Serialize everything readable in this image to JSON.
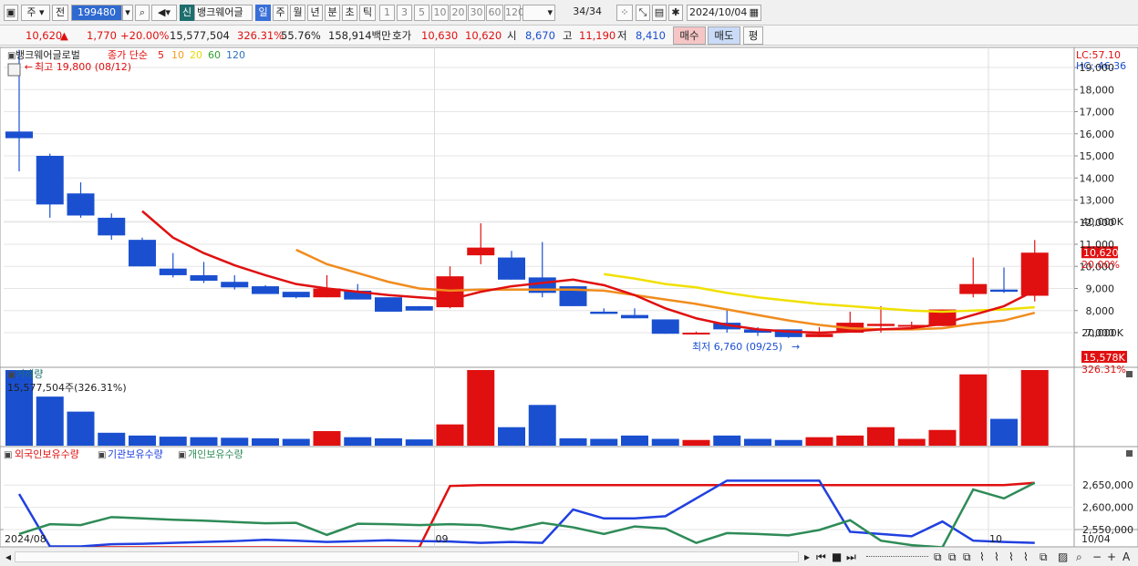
{
  "toolbar": {
    "market": "주",
    "prev": "전",
    "code": "199480",
    "new_badge": "신",
    "stock_name": "뱅크웨어글",
    "periods": [
      "일",
      "주",
      "월",
      "년",
      "분",
      "초",
      "틱"
    ],
    "active_period": "일",
    "intervals": [
      "1",
      "3",
      "5",
      "10",
      "20",
      "30",
      "60",
      "120"
    ],
    "count": "34",
    "count_total": "/34",
    "date": "2024/10/04"
  },
  "info": {
    "price": "10,620",
    "change_arrow": "▲",
    "change": "1,770",
    "change_pct": "+20.00%",
    "volume": "15,577,504",
    "volume_pct": "326.31%",
    "turnover": "55.76%",
    "amount": "158,914백만",
    "quote_label": "호가",
    "ask": "10,630",
    "bid": "10,620",
    "open_label": "시",
    "open": "8,670",
    "high_label": "고",
    "high": "11,190",
    "low_label": "저",
    "low": "8,410",
    "buy_btn": "매수",
    "sell_btn": "매도",
    "eval_btn": "평"
  },
  "price_panel": {
    "title": "뱅크웨어글로벌",
    "ma_label": "종가 단순",
    "ma_periods": [
      "5",
      "10",
      "20",
      "60",
      "120"
    ],
    "ma_colors": [
      "#e01010",
      "#f0a020",
      "#f0e000",
      "#30a030",
      "#3070c0"
    ],
    "lc": "LC:57.10",
    "hc": "HC:-46.36",
    "max_note": "최고 19,800 (08/12)",
    "min_note": "최저 6,760 (09/25)",
    "current_tag": "10,620",
    "current_pct_tag": "20.00%"
  },
  "volume_panel": {
    "title": "거래량",
    "note": "15,577,504주(326.31%)",
    "current_tag": "15,578K",
    "current_pct_tag": "326.31%"
  },
  "holding_panel": {
    "series_labels": [
      "외국인보유수량",
      "기관보유수량",
      "개인보유수량"
    ],
    "series_colors": [
      "#e01010",
      "#2040e0",
      "#2e8b57"
    ]
  },
  "x_labels": [
    {
      "idx": 0,
      "text": "2024/08"
    },
    {
      "idx": 14,
      "text": "09"
    },
    {
      "idx": 32,
      "text": "10"
    }
  ],
  "x_end_label": "10/04",
  "chart_data": [
    {
      "type": "candlestick",
      "title": "뱅크웨어글로벌",
      "ylim": [
        6000,
        20000
      ],
      "y_ticks": [
        7000,
        8000,
        9000,
        10000,
        11000,
        12000,
        13000,
        14000,
        15000,
        16000,
        17000,
        18000,
        19000
      ],
      "y_tick_labels": [
        "7,000",
        "8,000",
        "9,000",
        "10,000",
        "11,000",
        "12,000",
        "13,000",
        "14,000",
        "15,000",
        "16,000",
        "17,000",
        "18,000",
        "19,000"
      ],
      "candles": [
        {
          "o": 15800,
          "c": 16100,
          "h": 19800,
          "l": 14300,
          "dir": "down"
        },
        {
          "o": 15000,
          "c": 12800,
          "h": 15100,
          "l": 12200,
          "dir": "down"
        },
        {
          "o": 13300,
          "c": 12300,
          "h": 13800,
          "l": 12200,
          "dir": "down"
        },
        {
          "o": 12200,
          "c": 11400,
          "h": 12400,
          "l": 11200,
          "dir": "down"
        },
        {
          "o": 11200,
          "c": 10000,
          "h": 11300,
          "l": 10000,
          "dir": "down"
        },
        {
          "o": 9900,
          "c": 9600,
          "h": 10600,
          "l": 9500,
          "dir": "down"
        },
        {
          "o": 9600,
          "c": 9350,
          "h": 10200,
          "l": 9250,
          "dir": "down"
        },
        {
          "o": 9300,
          "c": 9050,
          "h": 9600,
          "l": 8950,
          "dir": "down"
        },
        {
          "o": 9100,
          "c": 8750,
          "h": 9150,
          "l": 8750,
          "dir": "down"
        },
        {
          "o": 8850,
          "c": 8600,
          "h": 8850,
          "l": 8550,
          "dir": "down"
        },
        {
          "o": 8600,
          "c": 9000,
          "h": 9600,
          "l": 8600,
          "dir": "up"
        },
        {
          "o": 8900,
          "c": 8500,
          "h": 9200,
          "l": 8500,
          "dir": "down"
        },
        {
          "o": 8600,
          "c": 7950,
          "h": 8600,
          "l": 7950,
          "dir": "down"
        },
        {
          "o": 8200,
          "c": 8000,
          "h": 8200,
          "l": 8000,
          "dir": "down"
        },
        {
          "o": 8150,
          "c": 9550,
          "h": 10000,
          "l": 8100,
          "dir": "up"
        },
        {
          "o": 10500,
          "c": 10850,
          "h": 11950,
          "l": 10100,
          "dir": "up"
        },
        {
          "o": 10400,
          "c": 9400,
          "h": 10700,
          "l": 9400,
          "dir": "down"
        },
        {
          "o": 9500,
          "c": 8800,
          "h": 11100,
          "l": 8600,
          "dir": "down"
        },
        {
          "o": 9100,
          "c": 8200,
          "h": 9100,
          "l": 8200,
          "dir": "down"
        },
        {
          "o": 7950,
          "c": 7850,
          "h": 8100,
          "l": 7850,
          "dir": "down"
        },
        {
          "o": 7800,
          "c": 7650,
          "h": 8100,
          "l": 7650,
          "dir": "down"
        },
        {
          "o": 7600,
          "c": 6950,
          "h": 7600,
          "l": 6950,
          "dir": "down"
        },
        {
          "o": 7000,
          "c": 7000,
          "h": 7050,
          "l": 6950,
          "dir": "up"
        },
        {
          "o": 7450,
          "c": 7150,
          "h": 8050,
          "l": 7000,
          "dir": "down"
        },
        {
          "o": 7150,
          "c": 7000,
          "h": 7250,
          "l": 6850,
          "dir": "down"
        },
        {
          "o": 7150,
          "c": 6800,
          "h": 7150,
          "l": 6760,
          "dir": "down"
        },
        {
          "o": 6800,
          "c": 6950,
          "h": 7250,
          "l": 6800,
          "dir": "up"
        },
        {
          "o": 7000,
          "c": 7450,
          "h": 7950,
          "l": 7000,
          "dir": "up"
        },
        {
          "o": 7300,
          "c": 7400,
          "h": 8200,
          "l": 7000,
          "dir": "up"
        },
        {
          "o": 7350,
          "c": 7350,
          "h": 7500,
          "l": 7200,
          "dir": "up"
        },
        {
          "o": 7300,
          "c": 8050,
          "h": 8050,
          "l": 7300,
          "dir": "up"
        },
        {
          "o": 8750,
          "c": 9200,
          "h": 10400,
          "l": 8600,
          "dir": "up"
        },
        {
          "o": 8950,
          "c": 8850,
          "h": 9950,
          "l": 8800,
          "dir": "down"
        },
        {
          "o": 8670,
          "c": 10620,
          "h": 11190,
          "l": 8410,
          "dir": "up"
        }
      ],
      "ma5": [
        null,
        null,
        null,
        null,
        12500,
        11300,
        10600,
        10050,
        9600,
        9200,
        9000,
        8850,
        8700,
        8600,
        8500,
        8850,
        9100,
        9250,
        9400,
        9150,
        8700,
        8100,
        7650,
        7350,
        7150,
        7050,
        7000,
        7050,
        7150,
        7200,
        7400,
        7800,
        8200,
        8900
      ],
      "ma10": [
        null,
        null,
        null,
        null,
        null,
        null,
        null,
        null,
        null,
        10750,
        10100,
        9700,
        9300,
        9000,
        8900,
        8950,
        8950,
        8950,
        8950,
        8900,
        8700,
        8500,
        8300,
        8050,
        7800,
        7550,
        7350,
        7200,
        7150,
        7150,
        7200,
        7400,
        7550,
        7900
      ],
      "ma20": [
        null,
        null,
        null,
        null,
        null,
        null,
        null,
        null,
        null,
        null,
        null,
        null,
        null,
        null,
        null,
        null,
        null,
        null,
        null,
        9650,
        9450,
        9200,
        9050,
        8800,
        8600,
        8450,
        8300,
        8200,
        8100,
        8000,
        7950,
        8000,
        8050,
        8150
      ]
    },
    {
      "type": "bar",
      "title": "거래량",
      "ylim": [
        0,
        40000
      ],
      "y_ticks": [
        20000,
        40000
      ],
      "y_tick_labels": [
        "20,000K",
        "40,000K"
      ],
      "unit": "K",
      "values": [
        41000,
        8500,
        5800,
        2000,
        1500,
        1300,
        1200,
        1100,
        1000,
        900,
        2300,
        1200,
        1000,
        800,
        3500,
        16000,
        3000,
        7000,
        1000,
        900,
        1500,
        900,
        700,
        1500,
        900,
        700,
        1200,
        1500,
        3000,
        900,
        2500,
        12500,
        4500,
        15578
      ],
      "dirs": [
        "down",
        "down",
        "down",
        "down",
        "down",
        "down",
        "down",
        "down",
        "down",
        "down",
        "up",
        "down",
        "down",
        "down",
        "up",
        "up",
        "down",
        "down",
        "down",
        "down",
        "down",
        "down",
        "up",
        "down",
        "down",
        "down",
        "up",
        "up",
        "up",
        "up",
        "up",
        "up",
        "down",
        "up"
      ]
    },
    {
      "type": "line",
      "title": "보유수량",
      "ylim": [
        2510000,
        2660000
      ],
      "y_ticks": [
        2550000,
        2600000,
        2650000
      ],
      "y_tick_labels": [
        "2,550,000",
        "2,600,000",
        "2,650,000"
      ],
      "series": [
        {
          "name": "외국인보유수량",
          "values": [
            null,
            null,
            2510000,
            2510000,
            2510000,
            2510000,
            2510000,
            2510000,
            2510000,
            2510000,
            2510000,
            2510000,
            2510000,
            2510000,
            2648000,
            2650000,
            2650000,
            2650000,
            2650000,
            2650000,
            2650000,
            2650000,
            2650000,
            2650000,
            2650000,
            2650000,
            2650000,
            2650000,
            2650000,
            2650000,
            2650000,
            2650000,
            2650000,
            2655000
          ]
        },
        {
          "name": "기관보유수량",
          "values": [
            2630000,
            2512000,
            2512000,
            2517000,
            2518000,
            2520000,
            2522000,
            2524000,
            2527000,
            2525000,
            2522000,
            2524000,
            2526000,
            2524000,
            2523000,
            2520000,
            2522000,
            2520000,
            2595000,
            2575000,
            2575000,
            2580000,
            2620000,
            2660000,
            2660000,
            2660000,
            2660000,
            2545000,
            2540000,
            2535000,
            2568000,
            2525000,
            2522000,
            2520000
          ]
        },
        {
          "name": "개인보유수량",
          "values": [
            2540000,
            2562000,
            2560000,
            2578000,
            2575000,
            2572000,
            2570000,
            2567000,
            2564000,
            2565000,
            2538000,
            2563000,
            2562000,
            2560000,
            2562000,
            2560000,
            2550000,
            2565000,
            2555000,
            2540000,
            2557000,
            2552000,
            2520000,
            2542000,
            2540000,
            2537000,
            2549000,
            2571000,
            2525000,
            2515000,
            2510000,
            2640000,
            2620000,
            2655000
          ]
        }
      ]
    }
  ]
}
